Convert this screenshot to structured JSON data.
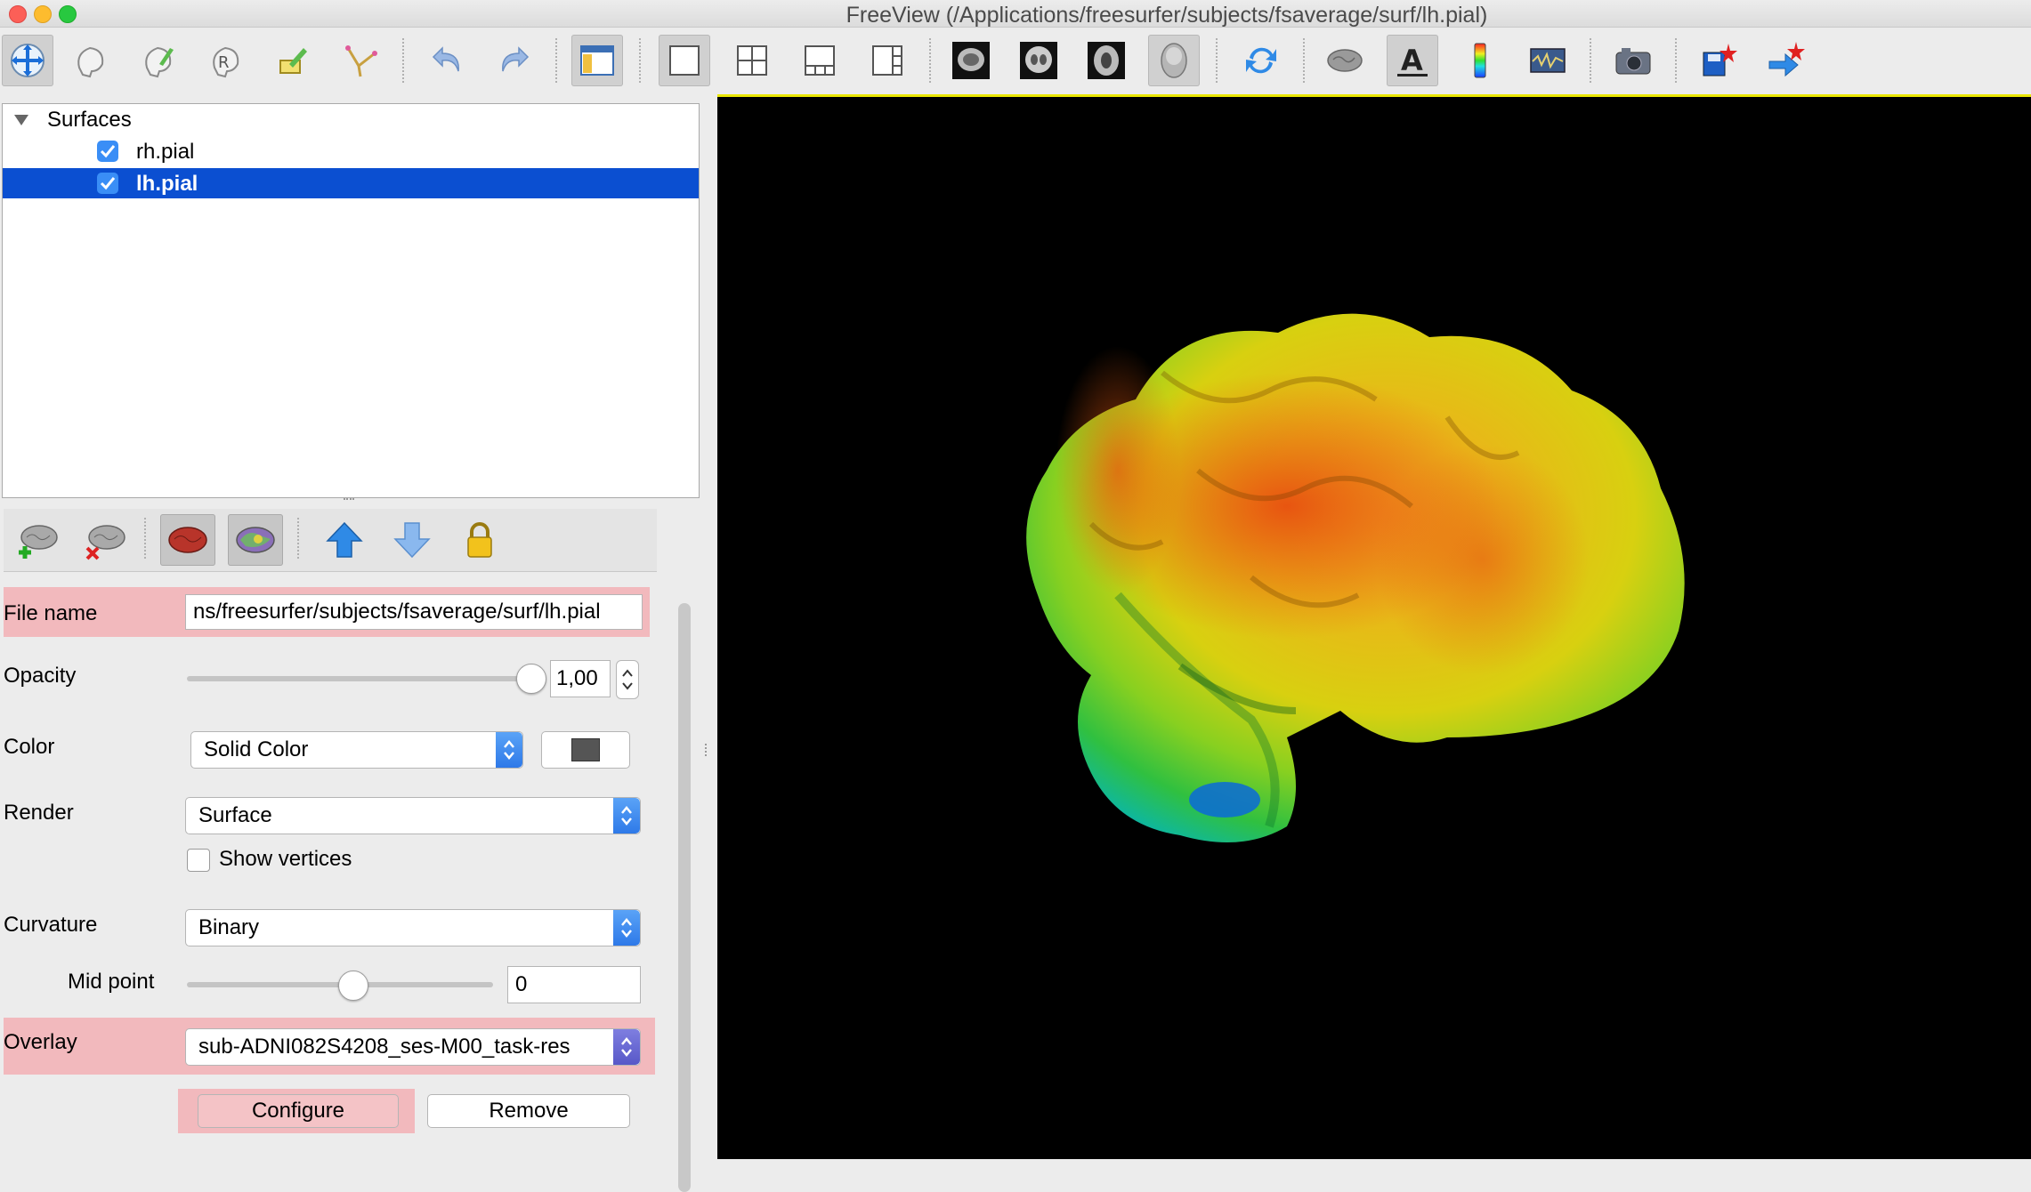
{
  "window": {
    "title": "FreeView (/Applications/freesurfer/subjects/fsaverage/surf/lh.pial)"
  },
  "colors": {
    "accent": "#0b4fd1",
    "viewport_bg": "#000000",
    "highlight": "#f2b9bd",
    "viewport_border": "#e9e600"
  },
  "toolbar": {
    "buttons": [
      {
        "icon": "navigate-icon"
      },
      {
        "icon": "voxel-edit-icon"
      },
      {
        "icon": "recon-edit-icon"
      },
      {
        "icon": "roi-edit-icon"
      },
      {
        "icon": "point-set-edit-icon"
      },
      {
        "icon": "measure-icon"
      },
      {
        "icon": "undo-icon"
      },
      {
        "icon": "redo-icon"
      },
      {
        "icon": "toggle-panel-icon"
      },
      {
        "icon": "layout-1x1-icon"
      },
      {
        "icon": "layout-2x2-icon"
      },
      {
        "icon": "layout-1-3-icon"
      },
      {
        "icon": "layout-1-3-vertical-icon"
      },
      {
        "icon": "sagittal-view-icon"
      },
      {
        "icon": "coronal-view-icon"
      },
      {
        "icon": "axial-view-icon"
      },
      {
        "icon": "3d-view-icon"
      },
      {
        "icon": "reset-view-icon"
      },
      {
        "icon": "show-brain-icon"
      },
      {
        "icon": "show-annotation-icon"
      },
      {
        "icon": "color-bar-icon"
      },
      {
        "icon": "info-panel-icon"
      },
      {
        "icon": "screenshot-icon"
      },
      {
        "icon": "save-point-icon"
      },
      {
        "icon": "goto-point-icon"
      }
    ]
  },
  "tree": {
    "group_label": "Surfaces",
    "items": [
      {
        "label": "rh.pial",
        "checked": true,
        "selected": false
      },
      {
        "label": "lh.pial",
        "checked": true,
        "selected": true
      }
    ]
  },
  "panel_tools": [
    "add-surface-icon",
    "remove-surface-icon",
    "surface-color-icon",
    "surface-overlay-icon",
    "move-up-icon",
    "move-down-icon",
    "lock-icon"
  ],
  "props": {
    "file_name_label": "File name",
    "file_name_value": "ns/freesurfer/subjects/fsaverage/surf/lh.pial",
    "opacity_label": "Opacity",
    "opacity_value": "1,00",
    "opacity_level": 1.0,
    "color_label": "Color",
    "color_value": "Solid Color",
    "color_swatch": "#555555",
    "render_label": "Render",
    "render_value": "Surface",
    "show_vertices_label": "Show vertices",
    "show_vertices_checked": false,
    "curvature_label": "Curvature",
    "curvature_value": "Binary",
    "midpoint_label": "Mid point",
    "midpoint_value": "0",
    "overlay_label": "Overlay",
    "overlay_value": "sub-ADNI082S4208_ses-M00_task-res",
    "configure_label": "Configure",
    "remove_label": "Remove"
  }
}
